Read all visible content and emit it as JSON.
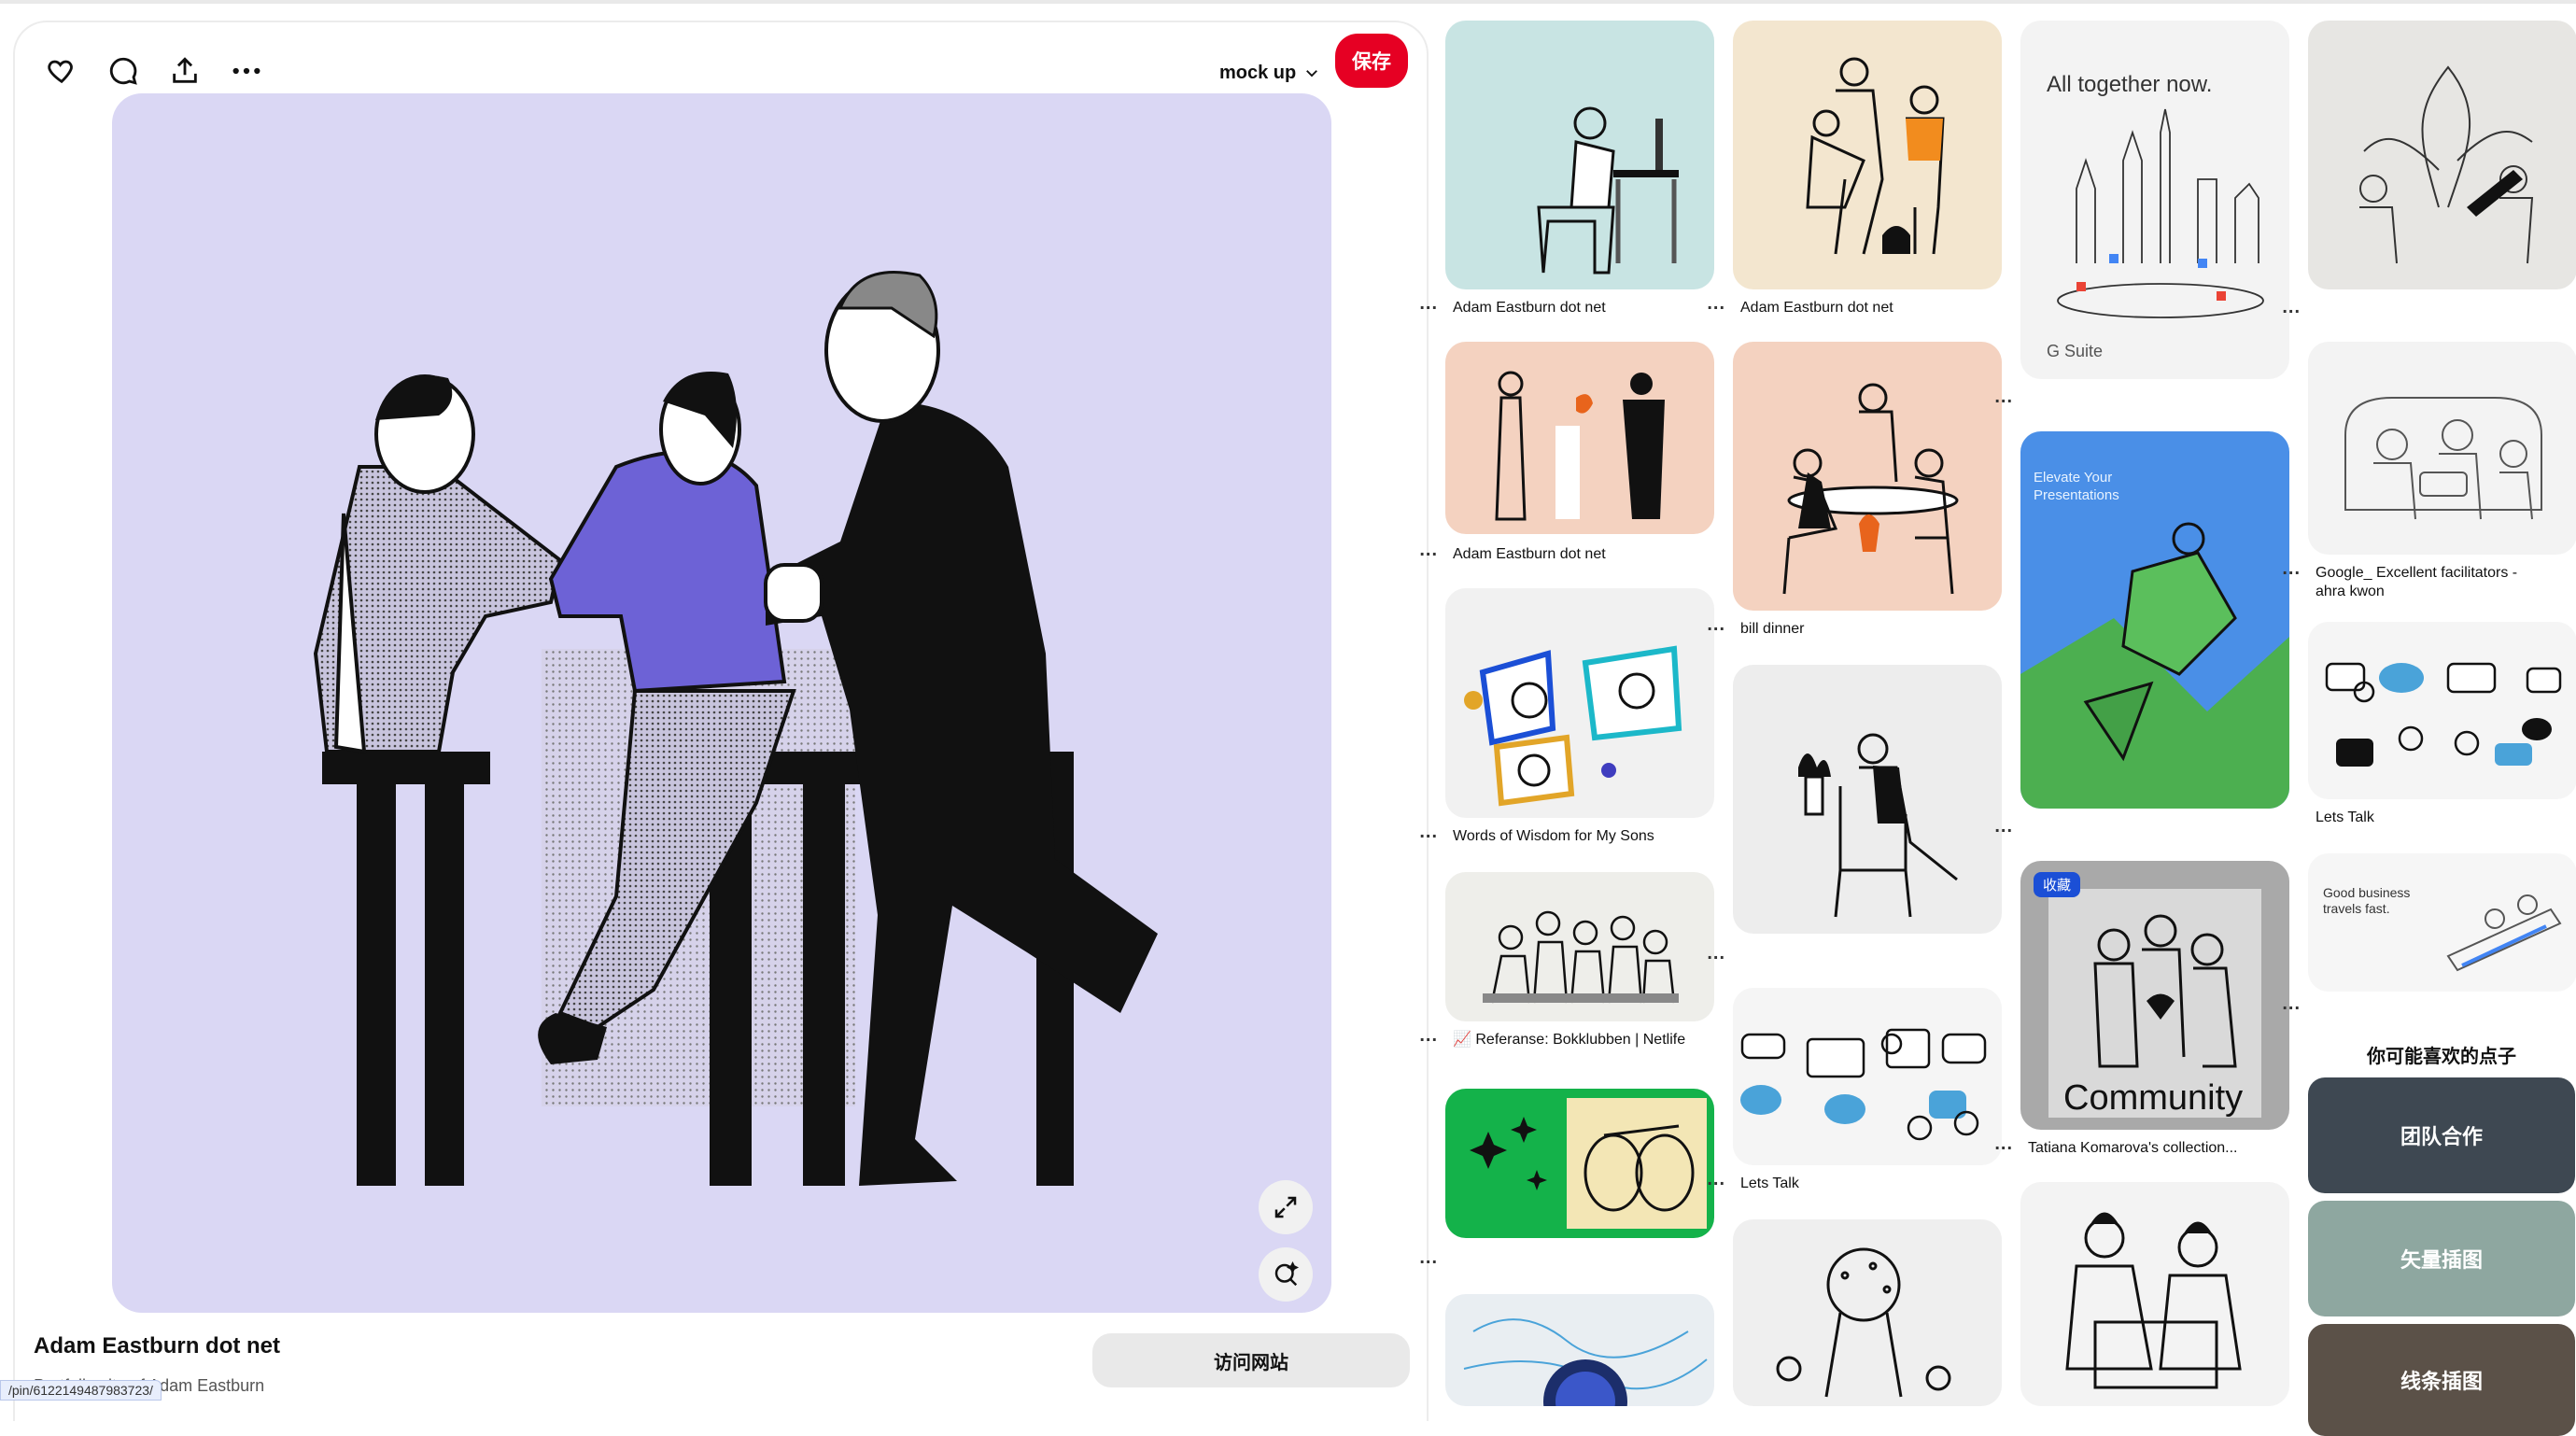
{
  "pin": {
    "board_name": "mock up",
    "save_label": "保存",
    "title": "Adam Eastburn dot net",
    "subtitle": "Portfolio site of Adam Eastburn",
    "visit_label": "访问网站",
    "status_url": "/pin/6122149487983723/"
  },
  "grid": {
    "cards": [
      {
        "title": "Adam Eastburn dot net",
        "more": "..."
      },
      {
        "title": "Adam Eastburn dot net",
        "more": "..."
      },
      {
        "title": "Words of Wisdom for My Sons",
        "more": "..."
      },
      {
        "title": "📈 Referanse: Bokklubben | Netlife",
        "more": "..."
      },
      {
        "title": "",
        "more": "..."
      },
      {
        "title": "Adam Eastburn dot net",
        "more": "..."
      },
      {
        "title": "bill dinner",
        "more": "..."
      },
      {
        "title": "",
        "more": "..."
      },
      {
        "title": "Lets Talk",
        "more": "..."
      },
      {
        "title": "",
        "more": "..."
      },
      {
        "title": "",
        "more": "..."
      },
      {
        "title": "Tatiana Komarova's collection...",
        "more": "..."
      },
      {
        "title": "",
        "more": "..."
      },
      {
        "title": "Google_ Excellent facilitators - ahra kwon",
        "more": "..."
      },
      {
        "title": "Lets Talk",
        "more": "..."
      },
      {
        "title": "",
        "more": "..."
      }
    ],
    "gsuite_heading": "All together now.",
    "gsuite_footer": "G Suite",
    "elevate_text": "Elevate Your Presentations",
    "good_business_text": "Good business travels fast.",
    "collected_badge": "收藏",
    "community_text": "Community"
  },
  "ideas": {
    "heading": "你可能喜欢的点子",
    "tiles": [
      "团队合作",
      "矢量插图",
      "线条插图"
    ]
  },
  "colors": {
    "save": "#e60023",
    "pin_bg": "#dad7f4",
    "shirt_purple": "#6d62d6",
    "teal_card": "#c8e4e3",
    "peach_card": "#f4d2c0",
    "cream_card": "#f3e6cf",
    "green_card": "#14b24a",
    "blue_card": "#4a8fe7"
  }
}
